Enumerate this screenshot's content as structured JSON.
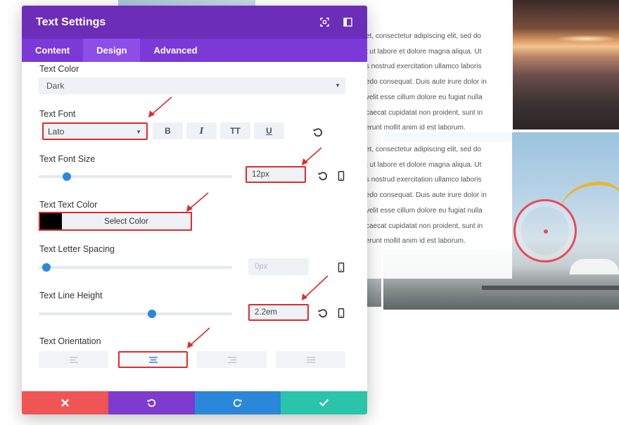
{
  "modal": {
    "title": "Text Settings",
    "tabs": [
      {
        "label": "Content",
        "active": false
      },
      {
        "label": "Design",
        "active": true
      },
      {
        "label": "Advanced",
        "active": false
      }
    ]
  },
  "fields": {
    "text_color": {
      "label": "Text Color",
      "value": "Dark"
    },
    "text_font": {
      "label": "Text Font",
      "value": "Lato",
      "styles": [
        "B",
        "I",
        "TT",
        "U"
      ]
    },
    "text_font_size": {
      "label": "Text Font Size",
      "value": "12px",
      "slider_fraction": 0.13
    },
    "text_text_color": {
      "label": "Text Text Color",
      "button": "Select Color",
      "swatch": "#000000"
    },
    "text_letter_spacing": {
      "label": "Text Letter Spacing",
      "value": "0px",
      "slider_fraction": 0.02
    },
    "text_line_height": {
      "label": "Text Line Height",
      "value": "2.2em",
      "slider_fraction": 0.59
    },
    "text_orientation": {
      "label": "Text Orientation",
      "options": [
        "left",
        "center",
        "right",
        "justify"
      ],
      "selected": "center"
    }
  },
  "background_text": {
    "lines": [
      "et, consectetur adipiscing elit, sed do",
      "t ut labore et dolore magna aliqua. Ut",
      "s nostrud exercitation ullamco laboris",
      "edo consequat. Duis aute irure dolor in",
      "velit esse cillum dolore eu fugiat nulla",
      "caecat cupidatat non proident, sunt in",
      "erunt mollit anim id est laborum."
    ]
  },
  "colors": {
    "header": "#6c2eb9",
    "tabs": "#7b39d8",
    "accent_blue": "#2b87da",
    "cancel": "#ef5555",
    "undo": "#7e3bd0",
    "redo": "#2b87da",
    "save": "#29c4a9",
    "highlight": "#e02b2b"
  }
}
